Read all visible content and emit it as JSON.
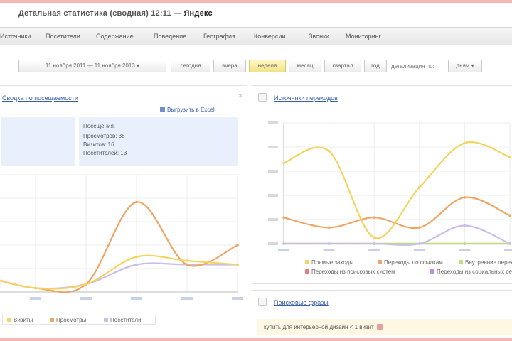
{
  "header": {
    "title_prefix": "Детальная статистика (сводная) 12:11 — ",
    "title_domain": "Яндекс"
  },
  "nav": {
    "items": [
      "Источники",
      "Посетители",
      "Содержание",
      "Поведение",
      "Геогрaфия",
      "Конверсии",
      "Звонки",
      "Мониторинг"
    ]
  },
  "toolbar": {
    "date_range": "11 ноября 2011 — 11 ноября 2013 ▾",
    "buttons": [
      "сегодня",
      "вчера",
      "неделя",
      "месяц",
      "квартал",
      "год"
    ],
    "active_index": 2,
    "detail_label": "детализация по:",
    "detail_value": "дням ▾"
  },
  "left_panel": {
    "title": "Сводка по посещаемости",
    "export_label": "Выгрузить в Excel",
    "summary_title": "Посещения:",
    "summary_lines": [
      "Просмотров: 38",
      "Визитов: 16",
      "Посетителей: 13"
    ],
    "legend": [
      "Визиты",
      "Просмотры",
      "Посетители"
    ]
  },
  "right_panel": {
    "title": "Источники переходов",
    "legend": [
      "Прямые заходы",
      "Переходы по ссылкам",
      "Внутренние переходы",
      "Переходы из поисковых систем",
      "Переходы из социальных сетей"
    ]
  },
  "bottom_panel": {
    "title": "Поисковые фразы",
    "row_text": "купить для интерьерной дизайн",
    "row_value": "< 1 визит"
  },
  "colors": {
    "accent": "#3a5fa8",
    "yellow": "#f4d35e",
    "orange": "#f0a566",
    "lavender": "#c9bde9",
    "green": "#b6e07a",
    "red": "#e57b7b",
    "purple": "#c08ee0"
  },
  "chart_data": [
    {
      "type": "line",
      "title": "Сводка по посещаемости",
      "x": [
        "",
        "",
        "",
        "",
        "",
        ""
      ],
      "series": [
        {
          "name": "Визиты",
          "values": [
            4,
            1,
            2,
            9,
            8,
            7
          ]
        },
        {
          "name": "Просмотры",
          "values": [
            4,
            1,
            2,
            23,
            7,
            12
          ]
        },
        {
          "name": "Посетители",
          "values": [
            4,
            1,
            2,
            7,
            7,
            7
          ]
        }
      ],
      "ylim": [
        0,
        30
      ],
      "grid": true
    },
    {
      "type": "line",
      "title": "Источники переходов",
      "x": [
        "",
        "",
        "",
        "",
        "",
        ""
      ],
      "y_ticks": [
        "",
        "",
        "",
        "",
        "",
        ""
      ],
      "series": [
        {
          "name": "Прямые заходы",
          "values": [
            40,
            46,
            3,
            28,
            50,
            43
          ]
        },
        {
          "name": "Переходы по ссылкам",
          "values": [
            13,
            8,
            13,
            8,
            23,
            14
          ]
        },
        {
          "name": "Внутренние переходы",
          "values": [
            0,
            0,
            0,
            0,
            9,
            0
          ]
        },
        {
          "name": "Переходы из поисковых систем",
          "values": [
            0,
            0,
            0,
            0,
            0,
            0
          ]
        },
        {
          "name": "Переходы из социальных сетей",
          "values": [
            0,
            0,
            0,
            0,
            0,
            0
          ]
        }
      ],
      "ylim": [
        0,
        60
      ],
      "grid": true
    }
  ]
}
